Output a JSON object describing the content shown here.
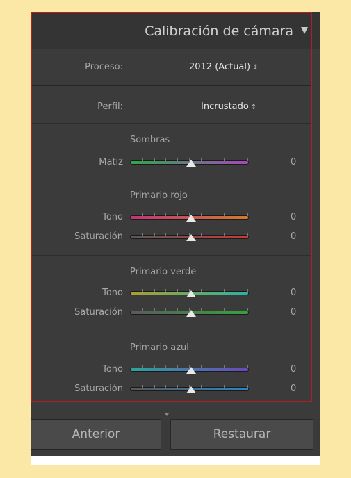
{
  "panel": {
    "title": "Calibración de cámara",
    "collapse_icon": "triangle-down-icon"
  },
  "proceso": {
    "label": "Proceso:",
    "value": "2012 (Actual)",
    "icon": "updown-arrows-icon"
  },
  "perfil": {
    "label": "Perfil:",
    "value": "Incrustado",
    "icon": "updown-arrows-icon"
  },
  "sections": {
    "sombras": {
      "title": "Sombras",
      "sliders": [
        {
          "label": "Matiz",
          "value": "0",
          "gradient": [
            "#2ea84a",
            "#a547b8"
          ]
        }
      ]
    },
    "rojo": {
      "title": "Primario rojo",
      "sliders": [
        {
          "label": "Tono",
          "value": "0",
          "gradient": [
            "#c0357a",
            "#d27b2c"
          ]
        },
        {
          "label": "Saturación",
          "value": "0",
          "gradient": [
            "#5a5a5a",
            "#c83a36"
          ]
        }
      ]
    },
    "verde": {
      "title": "Primario verde",
      "sliders": [
        {
          "label": "Tono",
          "value": "0",
          "gradient": [
            "#a9a02e",
            "#2bb3a2"
          ]
        },
        {
          "label": "Saturación",
          "value": "0",
          "gradient": [
            "#5a5a5a",
            "#36a33d"
          ]
        }
      ]
    },
    "azul": {
      "title": "Primario azul",
      "sliders": [
        {
          "label": "Tono",
          "value": "0",
          "gradient": [
            "#2aa69c",
            "#6a48bc"
          ]
        },
        {
          "label": "Saturación",
          "value": "0",
          "gradient": [
            "#5a5a5a",
            "#2f84c4"
          ]
        }
      ]
    }
  },
  "buttons": {
    "anterior": "Anterior",
    "restaurar": "Restaurar"
  },
  "colors": {
    "highlight_border": "#b31e22",
    "panel_bg": "#3b3b3b",
    "page_bg": "#fbe7a6"
  }
}
